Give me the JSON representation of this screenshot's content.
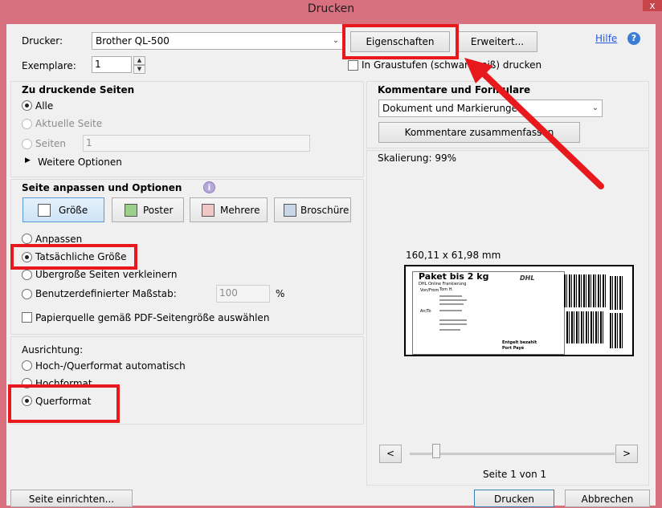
{
  "window": {
    "title": "Drucken",
    "close_label": "x"
  },
  "printer": {
    "label": "Drucker:",
    "value": "Brother QL-500",
    "properties_button": "Eigenschaften",
    "advanced_button": "Erweitert...",
    "help_link": "Hilfe",
    "help_icon_glyph": "?"
  },
  "copies": {
    "label": "Exemplare:",
    "value": "1",
    "up": "▲",
    "down": "▼"
  },
  "grayscale": {
    "label": "In Graustufen (schwarzweiß) drucken",
    "checked": false
  },
  "pages": {
    "heading": "Zu druckende Seiten",
    "all": "Alle",
    "current": "Aktuelle Seite",
    "range": "Seiten",
    "range_value": "1",
    "more": "Weitere Optionen",
    "more_glyph": "▶"
  },
  "sizing": {
    "heading": "Seite anpassen und Optionen",
    "info_glyph": "i",
    "buttons": [
      "Größe",
      "Poster",
      "Mehrere",
      "Broschüre"
    ],
    "options": [
      "Anpassen",
      "Tatsächliche Größe",
      "Übergroße Seiten verkleinern",
      "Benutzerdefinierter Maßstab:"
    ],
    "custom_scale": "100",
    "percent": "%",
    "paper_source": "Papierquelle gemäß PDF-Seitengröße auswählen"
  },
  "orientation": {
    "heading": "Ausrichtung:",
    "options": [
      "Hoch-/Querformat automatisch",
      "Hochformat",
      "Querformat"
    ]
  },
  "comments": {
    "heading": "Kommentare und Formulare",
    "value": "Dokument und Markierungen",
    "summarize_button": "Kommentare zusammenfassen"
  },
  "preview": {
    "scale_label": "Skalierung:",
    "scale_value": "99%",
    "dimensions": "160,11 x 61,98 mm",
    "page_info": "Seite 1 von 1",
    "prev": "<",
    "next": ">",
    "label": {
      "title": "Paket bis 2 kg",
      "subtitle": "DHL Online Frankierung",
      "brand": "DHL",
      "from_label": "Von/From",
      "from_name": "Tom H.",
      "to_label": "An/To",
      "postage_1": "Entgelt bezahlt",
      "postage_2": "Port Payé"
    }
  },
  "footer": {
    "page_setup_button": "Seite einrichten...",
    "print_button": "Drucken",
    "cancel_button": "Abbrechen"
  },
  "dropdown_glyph": "⌄",
  "colors": {
    "annotation_red": "#e8191d",
    "titlebar": "#d9707f",
    "dialog_bg": "#f0f0f0"
  }
}
